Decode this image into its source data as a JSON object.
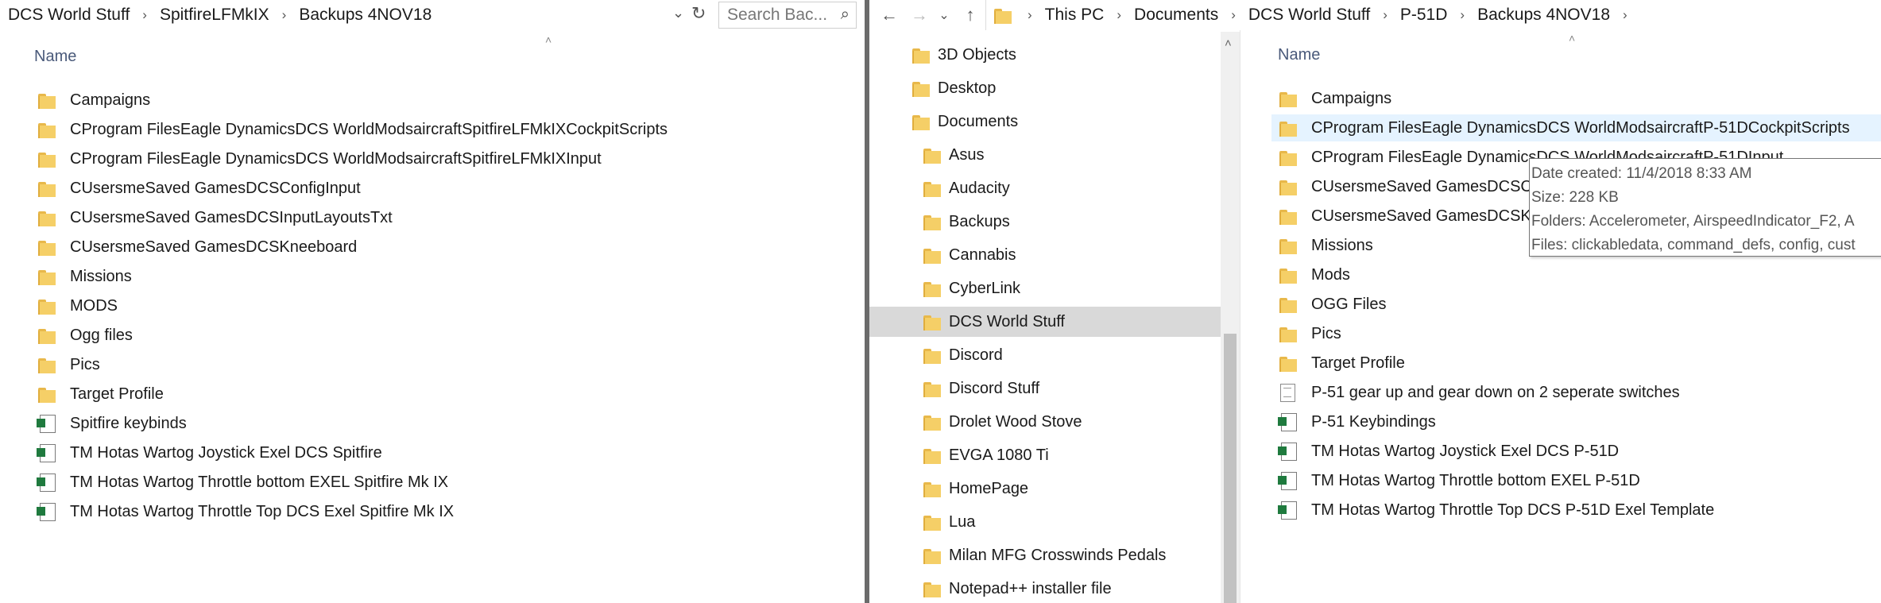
{
  "left": {
    "breadcrumbs": [
      "DCS World Stuff",
      "SpitfireLFMkIX",
      "Backups 4NOV18"
    ],
    "search_placeholder": "Search Bac...",
    "column_name": "Name",
    "items": [
      {
        "name": "Campaigns",
        "type": "folder"
      },
      {
        "name": "CProgram FilesEagle DynamicsDCS WorldModsaircraftSpitfireLFMkIXCockpitScripts",
        "type": "folder"
      },
      {
        "name": "CProgram FilesEagle DynamicsDCS WorldModsaircraftSpitfireLFMkIXInput",
        "type": "folder"
      },
      {
        "name": "CUsersmeSaved GamesDCSConfigInput",
        "type": "folder"
      },
      {
        "name": "CUsersmeSaved GamesDCSInputLayoutsTxt",
        "type": "folder"
      },
      {
        "name": "CUsersmeSaved GamesDCSKneeboard",
        "type": "folder"
      },
      {
        "name": "Missions",
        "type": "folder"
      },
      {
        "name": "MODS",
        "type": "folder"
      },
      {
        "name": "Ogg files",
        "type": "folder"
      },
      {
        "name": "Pics",
        "type": "folder"
      },
      {
        "name": "Target Profile",
        "type": "folder"
      },
      {
        "name": "Spitfire keybinds",
        "type": "excel"
      },
      {
        "name": "TM Hotas Wartog Joystick Exel DCS Spitfire",
        "type": "excel"
      },
      {
        "name": "TM Hotas Wartog Throttle bottom EXEL Spitfire Mk IX",
        "type": "excel"
      },
      {
        "name": "TM Hotas Wartog Throttle Top DCS Exel Spitfire Mk IX",
        "type": "excel"
      }
    ]
  },
  "right": {
    "breadcrumbs": [
      "This PC",
      "Documents",
      "DCS World Stuff",
      "P-51D",
      "Backups 4NOV18"
    ],
    "nav_tree": [
      {
        "name": "3D Objects",
        "level": 0
      },
      {
        "name": "Desktop",
        "level": 0
      },
      {
        "name": "Documents",
        "level": 0
      },
      {
        "name": "Asus",
        "level": 1
      },
      {
        "name": "Audacity",
        "level": 1
      },
      {
        "name": "Backups",
        "level": 1
      },
      {
        "name": "Cannabis",
        "level": 1
      },
      {
        "name": "CyberLink",
        "level": 1
      },
      {
        "name": "DCS World Stuff",
        "level": 1
      },
      {
        "name": "Discord",
        "level": 1
      },
      {
        "name": "Discord Stuff",
        "level": 1
      },
      {
        "name": "Drolet Wood Stove",
        "level": 1
      },
      {
        "name": "EVGA 1080 Ti",
        "level": 1
      },
      {
        "name": "HomePage",
        "level": 1
      },
      {
        "name": "Lua",
        "level": 1
      },
      {
        "name": "Milan MFG Crosswinds Pedals",
        "level": 1
      },
      {
        "name": "Notepad++ installer file",
        "level": 1
      }
    ],
    "column_name": "Name",
    "items": [
      {
        "name": "Campaigns",
        "type": "folder"
      },
      {
        "name": "CProgram FilesEagle DynamicsDCS WorldModsaircraftP-51DCockpitScripts",
        "type": "folder"
      },
      {
        "name": "CProgram FilesEagle DynamicsDCS WorldModsaircraftP-51DInput",
        "type": "folder"
      },
      {
        "name": "CUsersmeSaved GamesDCSConfigInput",
        "type": "folder"
      },
      {
        "name": "CUsersmeSaved GamesDCSKneeboard",
        "type": "folder"
      },
      {
        "name": "Missions",
        "type": "folder"
      },
      {
        "name": "Mods",
        "type": "folder"
      },
      {
        "name": "OGG Files",
        "type": "folder"
      },
      {
        "name": "Pics",
        "type": "folder"
      },
      {
        "name": "Target Profile",
        "type": "folder"
      },
      {
        "name": "P-51 gear up and gear down on 2 seperate switches",
        "type": "text"
      },
      {
        "name": "P-51 Keybindings",
        "type": "excel"
      },
      {
        "name": "TM Hotas Wartog Joystick Exel DCS P-51D",
        "type": "excel"
      },
      {
        "name": "TM Hotas Wartog Throttle bottom EXEL P-51D",
        "type": "excel"
      },
      {
        "name": "TM Hotas Wartog Throttle Top DCS P-51D Exel Template",
        "type": "excel"
      }
    ],
    "tooltip": {
      "date_created": "Date created: 11/4/2018 8:33 AM",
      "size": "Size: 228 KB",
      "folders": "Folders: Accelerometer, AirspeedIndicator_F2, A",
      "files": "Files: clickabledata, command_defs, config, cust"
    }
  }
}
